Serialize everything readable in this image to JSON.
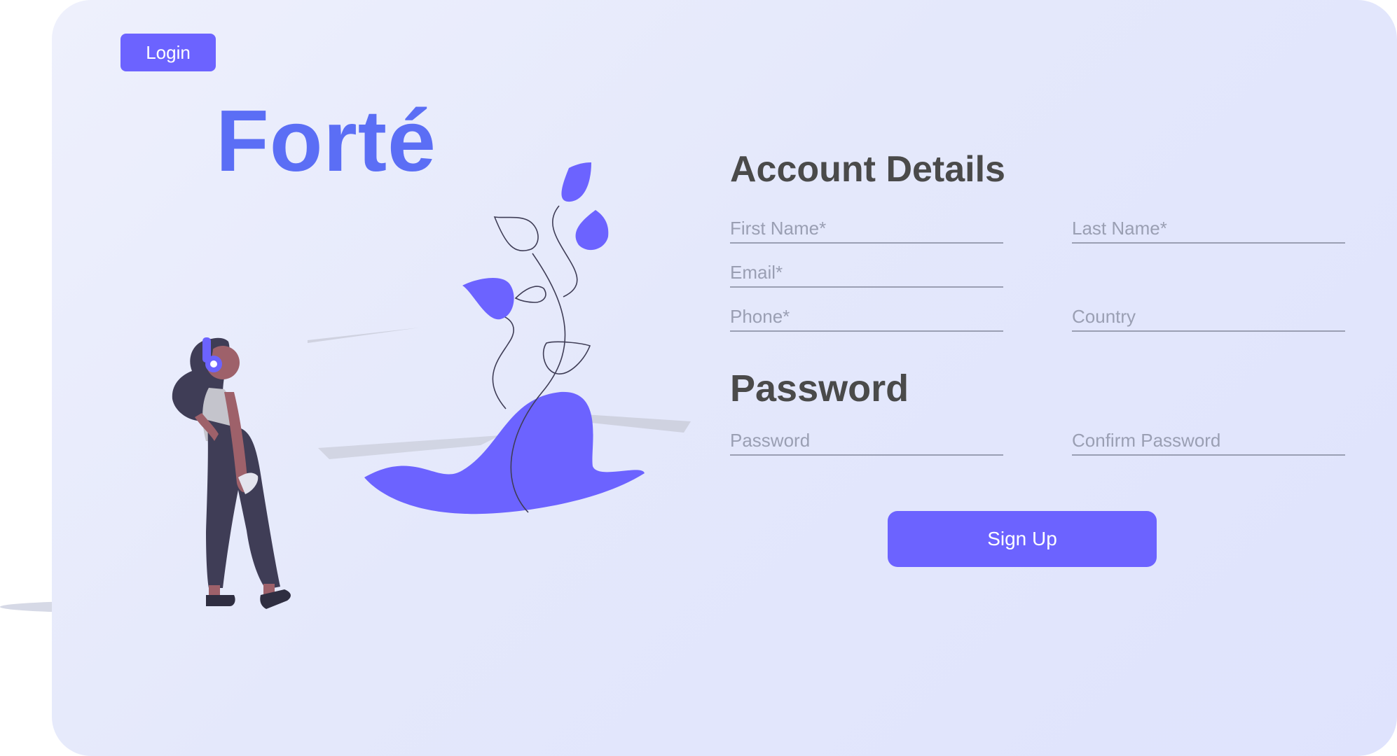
{
  "header": {
    "login_label": "Login"
  },
  "brand": {
    "name": "Forté"
  },
  "account_section": {
    "title": "Account  Details",
    "first_name_placeholder": "First Name*",
    "last_name_placeholder": "Last Name*",
    "email_placeholder": "Email*",
    "phone_placeholder": "Phone*",
    "country_placeholder": "Country"
  },
  "password_section": {
    "title": "Password",
    "password_placeholder": "Password",
    "confirm_placeholder": "Confirm Password"
  },
  "actions": {
    "signup_label": "Sign Up"
  },
  "colors": {
    "accent": "#6c63ff",
    "brand_text": "#5b6ef5",
    "heading_text": "#4a4a4a",
    "placeholder_text": "#9a9fb3",
    "background": "#e4e8fb"
  },
  "icons": [
    "person-with-headphones-illustration",
    "plant-illustration"
  ]
}
